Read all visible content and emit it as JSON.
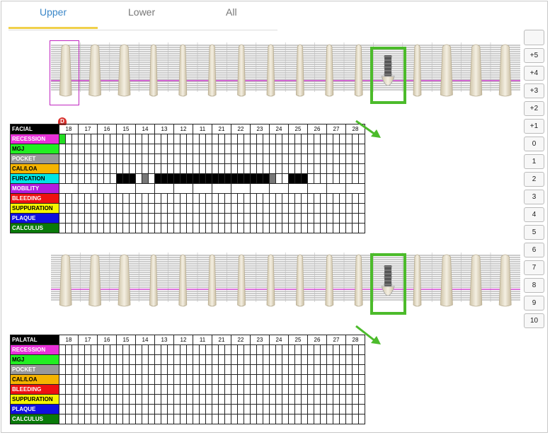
{
  "tabs": [
    {
      "label": "Upper",
      "active": true
    },
    {
      "label": "Lower",
      "active": false
    },
    {
      "label": "All",
      "active": false
    }
  ],
  "facial": {
    "title": "FACIAL",
    "tooth_numbers": [
      "18",
      "17",
      "16",
      "15",
      "14",
      "13",
      "12",
      "11",
      "21",
      "22",
      "23",
      "24",
      "25",
      "26",
      "27",
      "28"
    ],
    "rows": [
      {
        "label": "RECESSION",
        "color": "#e830d8",
        "text": "#ffffff"
      },
      {
        "label": "MGJ",
        "color": "#22ee22",
        "text": "#000000"
      },
      {
        "label": "POCKET",
        "color": "#999999",
        "text": "#ffffff"
      },
      {
        "label": "CAL/LOA",
        "color": "#f5b400",
        "text": "#000000"
      },
      {
        "label": "FURCATION",
        "color": "#00e5e5",
        "text": "#000000"
      },
      {
        "label": "MOBILITY",
        "color": "#b11de0",
        "text": "#ffffff"
      },
      {
        "label": "BLEEDING",
        "color": "#ee1111",
        "text": "#ffffff"
      },
      {
        "label": "SUPPURATION",
        "color": "#f5f500",
        "text": "#000000"
      },
      {
        "label": "PLAQUE",
        "color": "#1010e0",
        "text": "#ffffff"
      },
      {
        "label": "CALCULUS",
        "color": "#0a7a0a",
        "text": "#ffffff"
      }
    ],
    "badge": "D"
  },
  "palatal": {
    "title": "PALATAL",
    "tooth_numbers": [
      "18",
      "17",
      "16",
      "15",
      "14",
      "13",
      "12",
      "11",
      "21",
      "22",
      "23",
      "24",
      "25",
      "26",
      "27",
      "28"
    ],
    "rows": [
      {
        "label": "RECESSION",
        "color": "#e830d8",
        "text": "#ffffff"
      },
      {
        "label": "MGJ",
        "color": "#22ee22",
        "text": "#000000"
      },
      {
        "label": "POCKET",
        "color": "#999999",
        "text": "#ffffff"
      },
      {
        "label": "CAL/LOA",
        "color": "#f5b400",
        "text": "#000000"
      },
      {
        "label": "BLEEDING",
        "color": "#ee1111",
        "text": "#ffffff"
      },
      {
        "label": "SUPPURATION",
        "color": "#f5f500",
        "text": "#000000"
      },
      {
        "label": "PLAQUE",
        "color": "#1010e0",
        "text": "#ffffff"
      },
      {
        "label": "CALCULUS",
        "color": "#0a7a0a",
        "text": "#ffffff"
      }
    ]
  },
  "scale_buttons": [
    "",
    "+5",
    "+4",
    "+3",
    "+2",
    "+1",
    "0",
    "1",
    "2",
    "3",
    "4",
    "5",
    "6",
    "7",
    "8",
    "9",
    "10"
  ],
  "colors": {
    "accent": "#3b87c8",
    "tab_underline": "#f0d04a",
    "gingival_line": "#d040d0",
    "highlight": "#4cbb2b"
  }
}
